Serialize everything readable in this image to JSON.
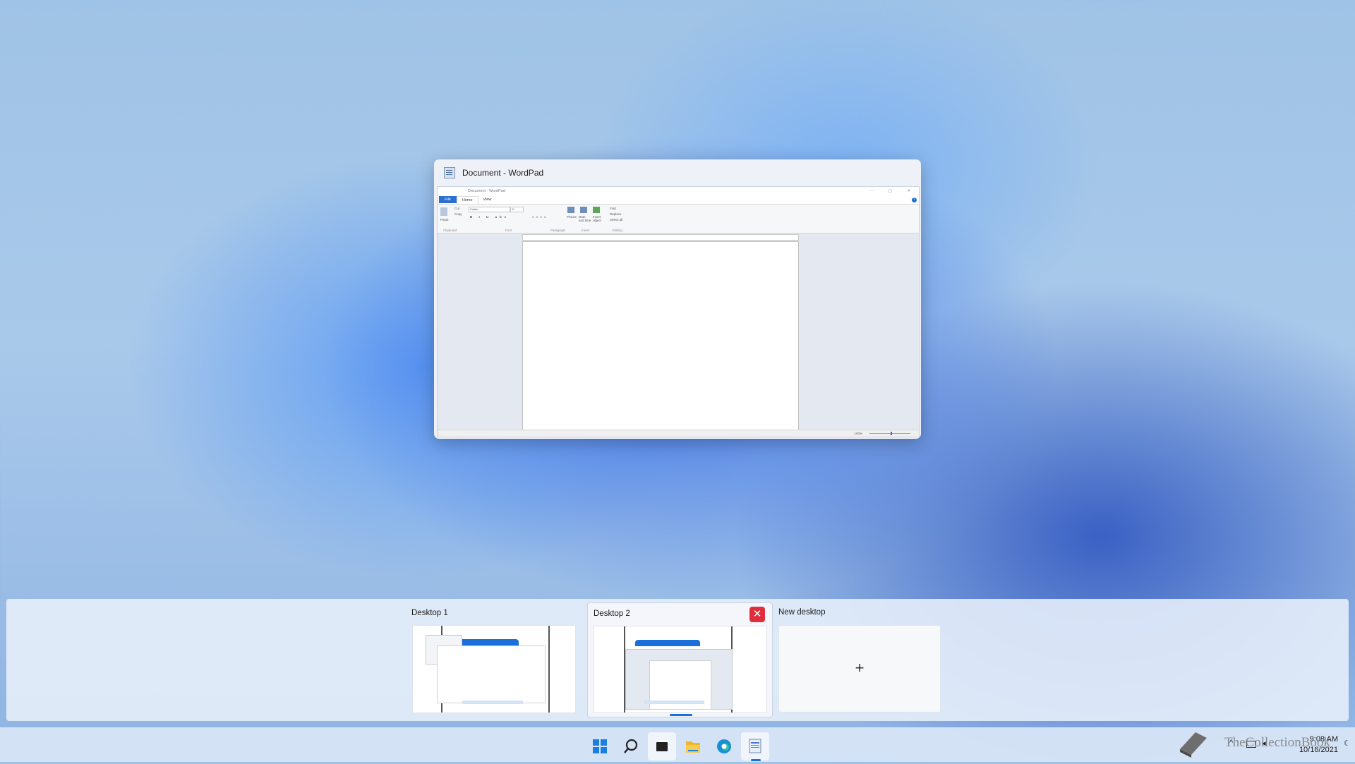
{
  "window": {
    "title": "Document - WordPad",
    "app": {
      "qat_title": "Document - WordPad",
      "tabs": [
        "File",
        "Home",
        "View"
      ],
      "groups": [
        "Clipboard",
        "Font",
        "Paragraph",
        "Insert",
        "Editing"
      ],
      "clipboard": [
        "Cut",
        "Copy",
        "Paste"
      ],
      "font_name": "Calibri",
      "font_size": "11",
      "insert": [
        "Picture",
        "Date and time",
        "Insert object"
      ],
      "editing": [
        "Find",
        "Replace",
        "Select all"
      ],
      "zoom": "100%"
    }
  },
  "taskview": {
    "desktops": [
      {
        "label": "Desktop 1"
      },
      {
        "label": "Desktop 2"
      },
      {
        "label": "New desktop"
      }
    ],
    "close_icon": "close-icon",
    "add_symbol": "+"
  },
  "taskbar": {
    "apps": [
      "start-icon",
      "search-icon",
      "task-view-icon",
      "file-explorer-icon",
      "edge-icon",
      "wordpad-icon"
    ],
    "clock_time": "9:08 AM",
    "clock_date": "10/16/2021"
  },
  "watermark": "TheCollectionBook",
  "colors": {
    "accent": "#1b6fd8",
    "close": "#e02d3d"
  }
}
